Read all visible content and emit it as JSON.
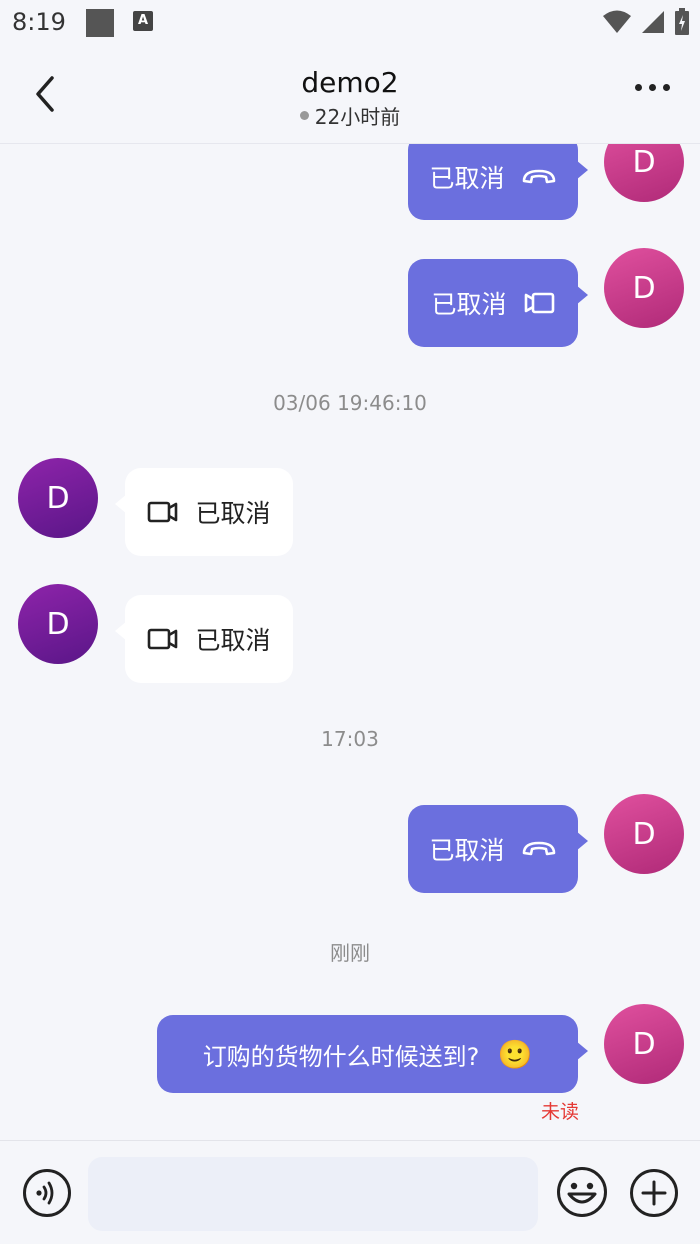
{
  "status_bar": {
    "time": "8:19",
    "notif_badge": "A"
  },
  "header": {
    "title": "demo2",
    "last_seen": "22小时前"
  },
  "messages": [
    {
      "text": "已取消"
    },
    {
      "text": "已取消"
    },
    {
      "time": "03/06 19:46:10"
    },
    {
      "text": "已取消"
    },
    {
      "text": "已取消"
    },
    {
      "time": "17:03"
    },
    {
      "text": "已取消"
    },
    {
      "time": "刚刚"
    },
    {
      "text": "订购的货物什么时候送到?",
      "emoji": "🙂",
      "status": "未读"
    }
  ],
  "avatar_letter": "D",
  "input": {
    "value": "",
    "placeholder": ""
  },
  "colors": {
    "outgoing_bubble": "#6b6fde",
    "incoming_bubble": "#ffffff",
    "unread": "#e53935",
    "background": "#f5f6fa"
  }
}
